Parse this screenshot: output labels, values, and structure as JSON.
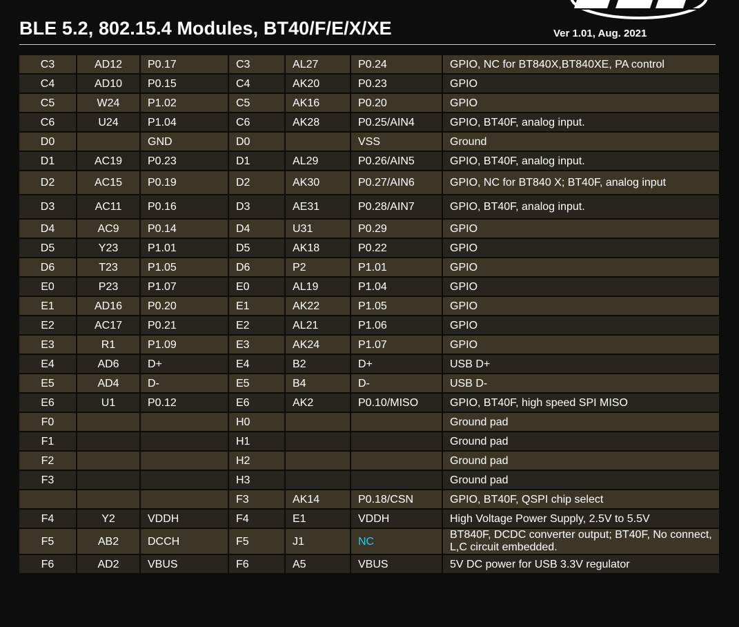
{
  "header": {
    "title": "BLE 5.2, 802.15.4 Modules, BT40/F/E/X/XE",
    "version": "Ver 1.01, Aug. 2021"
  },
  "accent_colors": {
    "row_dark": "#282520",
    "row_light": "#3d3525",
    "nc_text": "#2ec6e8"
  },
  "rows": [
    {
      "c0": "C3",
      "c1": "AD12",
      "c2": "P0.17",
      "c3": "C3",
      "c4": "AL27",
      "c5": "P0.24",
      "c6": "GPIO, NC for BT840X,BT840XE, PA control"
    },
    {
      "c0": "C4",
      "c1": "AD10",
      "c2": "P0.15",
      "c3": "C4",
      "c4": "AK20",
      "c5": "P0.23",
      "c6": "GPIO"
    },
    {
      "c0": "C5",
      "c1": "W24",
      "c2": "P1.02",
      "c3": "C5",
      "c4": "AK16",
      "c5": "P0.20",
      "c6": "GPIO"
    },
    {
      "c0": "C6",
      "c1": "U24",
      "c2": "P1.04",
      "c3": "C6",
      "c4": "AK28",
      "c5": "P0.25/AIN4",
      "c6": "GPIO, BT40F, analog input."
    },
    {
      "c0": "D0",
      "c1": "",
      "c2": "GND",
      "c3": "D0",
      "c4": "",
      "c5": "VSS",
      "c6": "Ground"
    },
    {
      "c0": "D1",
      "c1": "AC19",
      "c2": "P0.23",
      "c3": "D1",
      "c4": "AL29",
      "c5": "P0.26/AIN5",
      "c6": "GPIO, BT40F, analog input."
    },
    {
      "c0": "D2",
      "c1": "AC15",
      "c2": "P0.19",
      "c3": "D2",
      "c4": "AK30",
      "c5": "P0.27/AIN6",
      "c6": "GPIO, NC for BT840 X; BT40F, analog input"
    },
    {
      "c0": "D3",
      "c1": "AC11",
      "c2": "P0.16",
      "c3": "D3",
      "c4": "AE31",
      "c5": "P0.28/AIN7",
      "c6": "GPIO, BT40F, analog input."
    },
    {
      "c0": "D4",
      "c1": "AC9",
      "c2": "P0.14",
      "c3": "D4",
      "c4": "U31",
      "c5": "P0.29",
      "c6": "GPIO"
    },
    {
      "c0": "D5",
      "c1": "Y23",
      "c2": "P1.01",
      "c3": "D5",
      "c4": "AK18",
      "c5": "P0.22",
      "c6": "GPIO"
    },
    {
      "c0": "D6",
      "c1": "T23",
      "c2": "P1.05",
      "c3": "D6",
      "c4": "P2",
      "c5": "P1.01",
      "c6": "GPIO"
    },
    {
      "c0": "E0",
      "c1": "P23",
      "c2": "P1.07",
      "c3": "E0",
      "c4": "AL19",
      "c5": "P1.04",
      "c6": "GPIO"
    },
    {
      "c0": "E1",
      "c1": "AD16",
      "c2": "P0.20",
      "c3": "E1",
      "c4": "AK22",
      "c5": "P1.05",
      "c6": "GPIO"
    },
    {
      "c0": "E2",
      "c1": "AC17",
      "c2": "P0.21",
      "c3": "E2",
      "c4": "AL21",
      "c5": "P1.06",
      "c6": "GPIO"
    },
    {
      "c0": "E3",
      "c1": "R1",
      "c2": "P1.09",
      "c3": "E3",
      "c4": "AK24",
      "c5": "P1.07",
      "c6": "GPIO"
    },
    {
      "c0": "E4",
      "c1": "AD6",
      "c2": "D+",
      "c3": "E4",
      "c4": "B2",
      "c5": "D+",
      "c6": "USB D+"
    },
    {
      "c0": "E5",
      "c1": "AD4",
      "c2": "D-",
      "c3": "E5",
      "c4": "B4",
      "c5": "D-",
      "c6": "USB D-"
    },
    {
      "c0": "E6",
      "c1": "U1",
      "c2": "P0.12",
      "c3": "E6",
      "c4": "AK2",
      "c5": "P0.10/MISO",
      "c6": "GPIO, BT40F, high speed SPI MISO"
    },
    {
      "c0": "F0",
      "c1": "",
      "c2": "",
      "c3": "H0",
      "c4": "",
      "c5": "",
      "c6": "Ground pad"
    },
    {
      "c0": "F1",
      "c1": "",
      "c2": "",
      "c3": "H1",
      "c4": "",
      "c5": "",
      "c6": "Ground pad"
    },
    {
      "c0": "F2",
      "c1": "",
      "c2": "",
      "c3": "H2",
      "c4": "",
      "c5": "",
      "c6": "Ground pad"
    },
    {
      "c0": "F3",
      "c1": "",
      "c2": "",
      "c3": "H3",
      "c4": "",
      "c5": "",
      "c6": "Ground pad"
    },
    {
      "c0": "",
      "c1": "",
      "c2": "",
      "c3": "F3",
      "c4": "AK14",
      "c5": "P0.18/CSN",
      "c6": "GPIO, BT40F, QSPI chip select"
    },
    {
      "c0": "F4",
      "c1": "Y2",
      "c2": "VDDH",
      "c3": "F4",
      "c4": "E1",
      "c5": "VDDH",
      "c6": "High Voltage Power Supply, 2.5V to 5.5V"
    },
    {
      "c0": "F5",
      "c1": "AB2",
      "c2": "DCCH",
      "c3": "F5",
      "c4": "J1",
      "c5": "NC",
      "c6": "BT840F, DCDC converter output; BT40F, No connect, L,C circuit embedded."
    },
    {
      "c0": "F6",
      "c1": "AD2",
      "c2": "VBUS",
      "c3": "F6",
      "c4": "A5",
      "c5": "VBUS",
      "c6": "5V DC power for USB 3.3V regulator"
    }
  ]
}
